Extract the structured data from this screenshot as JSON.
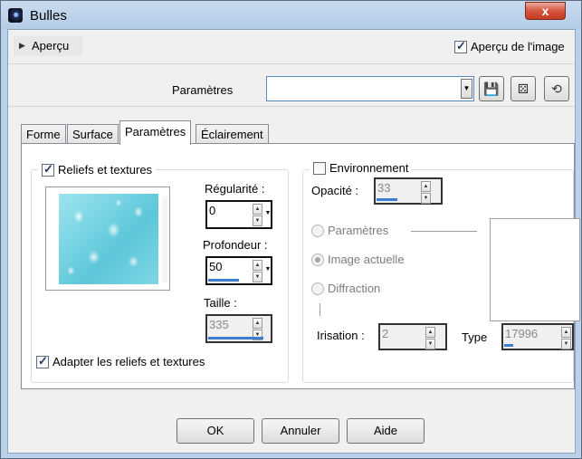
{
  "window": {
    "title": "Bulles",
    "close_glyph": "x"
  },
  "preview": {
    "toggle_label": "Aperçu",
    "image_preview_label": "Aperçu de l'image",
    "image_preview_checked": true
  },
  "presets": {
    "label": "Paramètres",
    "value": ""
  },
  "tabs": [
    {
      "label": "Forme",
      "active": false
    },
    {
      "label": "Surface",
      "active": false
    },
    {
      "label": "Paramètres",
      "active": true
    },
    {
      "label": "Éclairement",
      "active": false
    }
  ],
  "reliefs": {
    "label": "Reliefs et textures",
    "checked": true,
    "regularite": {
      "label": "Régularité :",
      "value": "0",
      "fill": 0
    },
    "profondeur": {
      "label": "Profondeur :",
      "value": "50",
      "fill": 0.5
    },
    "taille": {
      "label": "Taille :",
      "value": "335",
      "fill": 0.9
    },
    "adapt_label": "Adapter les reliefs et textures",
    "adapt_checked": true
  },
  "environment": {
    "label": "Environnement",
    "checked": false,
    "opacite": {
      "label": "Opacité :",
      "value": "33",
      "fill": 0.33
    },
    "options": [
      {
        "label": "Paramètres",
        "selected": false
      },
      {
        "label": "Image actuelle",
        "selected": true
      },
      {
        "label": "Diffraction",
        "selected": false
      }
    ],
    "irisation": {
      "label": "Irisation :",
      "value": "2"
    },
    "type": {
      "label": "Type",
      "value": "17996"
    }
  },
  "buttons": {
    "ok": "OK",
    "cancel": "Annuler",
    "help": "Aide"
  },
  "colors": {
    "accent": "#3c7ed1",
    "frame": "#b9d1ea",
    "close": "#d7553e"
  }
}
